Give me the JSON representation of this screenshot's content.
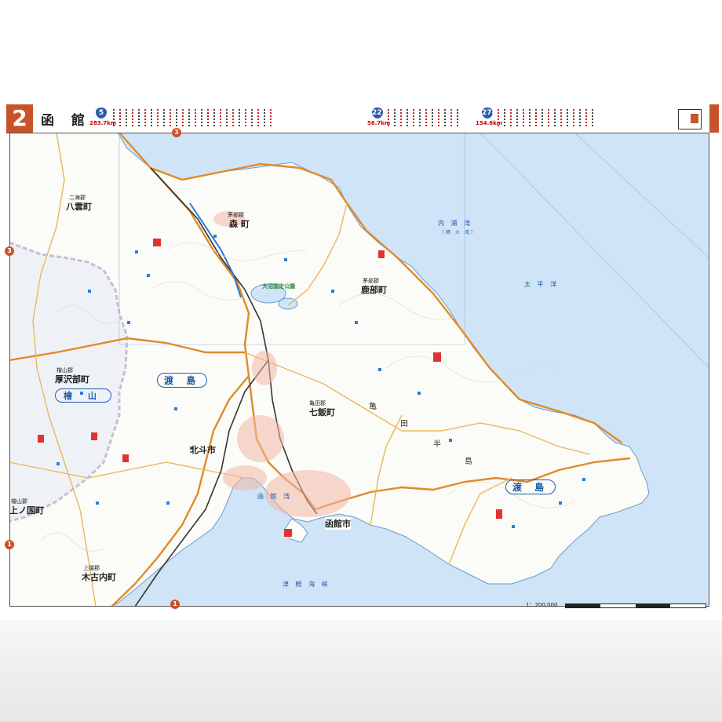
{
  "header": {
    "page_number": "2",
    "title": "函 館",
    "route_badges": [
      {
        "number": "5",
        "total": "283.7km"
      },
      {
        "number": "227",
        "total": "56.7km"
      },
      {
        "number": "278",
        "total": "154.6km"
      }
    ]
  },
  "markers": {
    "top": "3",
    "left_upper": "3",
    "left_lower": "1",
    "bottom": "1"
  },
  "labels": {
    "town_mori_pref": "茅部郡",
    "town_mori": "森 町",
    "town_shikabe_pref": "茅部郡",
    "town_shikabe": "鹿部町",
    "town_yakumo_pref": "二海郡",
    "town_yakumo": "八雲町",
    "town_assabu_pref": "檜山郡",
    "town_assabu": "厚沢部町",
    "town_kaminokuni_pref": "檜山郡",
    "town_kaminokuni": "上ノ国町",
    "town_kikonai_pref": "上磯郡",
    "town_kikonai": "木古内町",
    "town_nanae_pref": "亀田郡",
    "town_nanae": "七飯町",
    "city_hokuto": "北斗市",
    "city_hakodate": "函館市",
    "region_oshima_w": "渡 島",
    "region_oshima_e": "渡 島",
    "subpref_hiyama": "檜 山",
    "peninsula": [
      "亀",
      "田",
      "半",
      "島"
    ],
    "bay_uchiura": "内 浦 湾",
    "bay_uchiura_sub": "（噴 火 湾）",
    "pacific": "太 平 洋",
    "bay_hakodate": "函 館 湾",
    "strait_tsugaru": "津 軽 海 峡",
    "park_onuma": "大沼国定公園"
  },
  "scale": {
    "ratio": "1：200,000"
  },
  "colors": {
    "accent": "#c8532a",
    "sea": "#cfe4f6",
    "land": "#ffffff",
    "road_national": "#e08a2a",
    "road_pref": "#e9b95b",
    "rail": "#333333",
    "label_blue": "#1f5ca8"
  }
}
